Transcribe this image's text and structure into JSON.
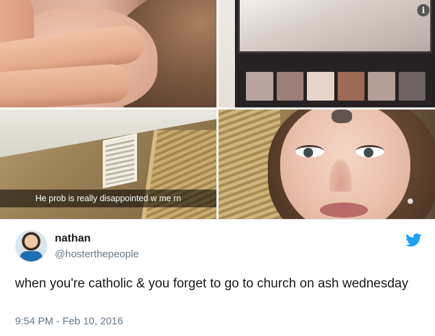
{
  "media": {
    "caption": "He prob is really disappointed w me rn",
    "palette_colors": [
      "#b9a5a0",
      "#9c7f78",
      "#e8d3c9",
      "#9e6a55",
      "#b59d98",
      "#6d6261"
    ],
    "info_icon_symbol": "i"
  },
  "tweet": {
    "name": "nathan",
    "handle": "@hosterthepeople",
    "text": "when you're catholic & you forget to go to church on ash wednesday",
    "timestamp": "9:54 PM - Feb 10, 2016",
    "brand_color": "#1da1f2"
  }
}
